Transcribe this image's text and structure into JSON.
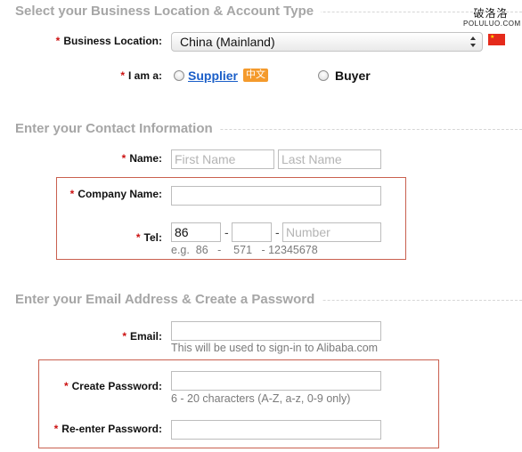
{
  "watermark": {
    "chinese": "破洛洛",
    "latin": "POLULUO.COM"
  },
  "section1": {
    "title": "Select your Business Location & Account Type",
    "business_location_label": "Business Location:",
    "business_location_value": "China (Mainland)",
    "iam_label": "I am a:",
    "supplier_label": "Supplier",
    "chinese_badge": "中文",
    "buyer_label": "Buyer"
  },
  "section2": {
    "title": "Enter your Contact Information",
    "name_label": "Name:",
    "first_name_placeholder": "First Name",
    "last_name_placeholder": "Last Name",
    "company_label": "Company Name:",
    "tel_label": "Tel:",
    "tel_country_value": "86",
    "tel_number_placeholder": "Number",
    "tel_separator": "-",
    "tel_example": "e.g.  86   -    571   - 12345678"
  },
  "section3": {
    "title": "Enter your Email Address & Create a Password",
    "email_label": "Email:",
    "email_hint": "This will be used to sign-in to Alibaba.com",
    "password_label": "Create Password:",
    "password_hint": "6 - 20 characters (A-Z, a-z, 0-9 only)",
    "reenter_label": "Re-enter Password:"
  },
  "required_mark": "*",
  "colors": {
    "required": "#cc1111",
    "highlight_box": "#c9604f",
    "link": "#1a5ec8",
    "badge": "#f49a2c",
    "section_title": "#a6a6a6"
  }
}
